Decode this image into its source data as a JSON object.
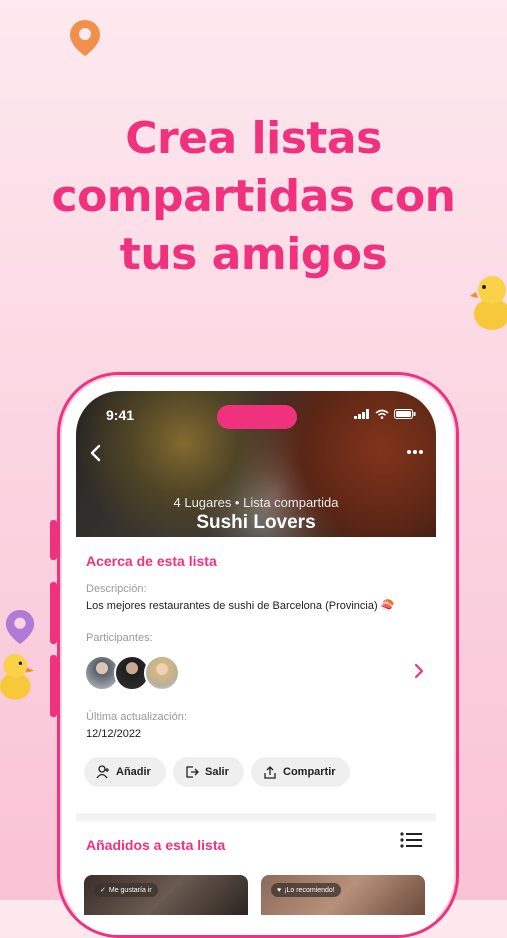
{
  "headline": {
    "line1": "Crea listas",
    "line2": "compartidas con",
    "line3": "tus amigos"
  },
  "colors": {
    "accent": "#f0327e",
    "pin_orange": "#f0904a",
    "pin_purple": "#b07ad6",
    "duck": "#f7c93a"
  },
  "status_bar": {
    "time": "9:41"
  },
  "list": {
    "meta": "4 Lugares • Lista compartida",
    "title": "Sushi Lovers"
  },
  "about": {
    "title": "Acerca de esta lista",
    "description_label": "Descripción:",
    "description": "Los mejores restaurantes de sushi de Barcelona (Provincia) 🍣",
    "participants_label": "Participantes:",
    "updated_label": "Última actualización:",
    "updated": "12/12/2022"
  },
  "actions": {
    "add": "Añadir",
    "leave": "Salir",
    "share": "Compartir"
  },
  "added": {
    "title": "Añadidos a esta lista",
    "cards": [
      {
        "badge": "Me gustaría ir"
      },
      {
        "badge": "¡Lo recomiendo!"
      }
    ]
  },
  "icons": [
    "map-pin-icon",
    "duck-icon",
    "back-arrow-icon",
    "more-icon",
    "signal-icon",
    "wifi-icon",
    "battery-icon",
    "chevron-right-icon",
    "add-user-icon",
    "exit-icon",
    "share-icon",
    "list-icon",
    "check-icon",
    "heart-icon"
  ]
}
